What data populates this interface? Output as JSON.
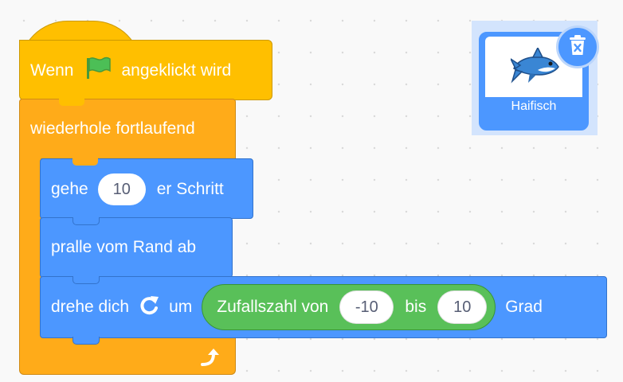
{
  "script": {
    "hat": {
      "before_flag": "Wenn",
      "after_flag": "angeklickt wird"
    },
    "forever": {
      "label": "wiederhole fortlaufend"
    },
    "move": {
      "label_before": "gehe",
      "steps": "10",
      "label_after": "er Schritt"
    },
    "bounce": {
      "label": "pralle vom Rand ab"
    },
    "turn": {
      "label_before": "drehe dich",
      "label_middle": "um",
      "random": {
        "label": "Zufallszahl von",
        "from": "-10",
        "connector": "bis",
        "to": "10"
      },
      "label_after": "Grad"
    }
  },
  "sprite": {
    "name": "Haifisch"
  },
  "colors": {
    "events": "#ffbf00",
    "control": "#ffab19",
    "motion": "#4c97ff",
    "operators": "#59c059",
    "flag": "#4cbf56"
  },
  "icons": {
    "flag": "green-flag-icon",
    "turn": "rotate-clockwise-icon",
    "loop": "loop-arrow-icon",
    "delete": "trash-icon"
  }
}
